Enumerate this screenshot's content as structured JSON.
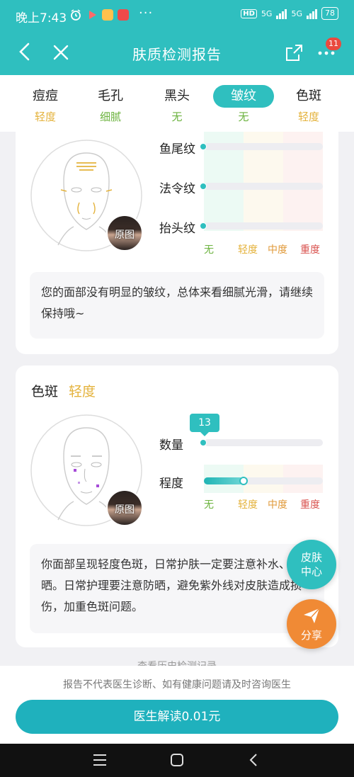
{
  "status_bar": {
    "time": "晚上7:43",
    "dots": "···",
    "hd": "HD",
    "net1": "5G",
    "net2": "5G",
    "battery": "78",
    "app_icon_colors": [
      "#ffffff",
      "#ff6a6a",
      "#ffc14d",
      "#f04a4a"
    ]
  },
  "nav": {
    "title": "肤质检测报告",
    "badge": "11"
  },
  "tabs": [
    {
      "label": "痘痘",
      "level": "轻度",
      "color": "#e4b23b"
    },
    {
      "label": "毛孔",
      "level": "细腻",
      "color": "#6cb33f"
    },
    {
      "label": "黑头",
      "level": "无",
      "color": "#6cb33f"
    },
    {
      "label": "皱纹",
      "level": "无",
      "color": "#6cb33f",
      "active": true
    },
    {
      "label": "色斑",
      "level": "轻度",
      "color": "#e4b23b"
    }
  ],
  "wrinkles": {
    "rows": [
      {
        "label": "鱼尾纹",
        "value": 0
      },
      {
        "label": "法令纹",
        "value": 0
      },
      {
        "label": "抬头纹",
        "value": 0
      }
    ],
    "scale": [
      "无",
      "轻度",
      "中度",
      "重度"
    ],
    "original_label": "原图",
    "note": "您的面部没有明显的皱纹，总体来看细腻光滑，请继续保持哦~"
  },
  "spots": {
    "title": "色斑",
    "level": "轻度",
    "count": "13",
    "rows": [
      {
        "label": "数量",
        "value": 0
      },
      {
        "label": "程度",
        "value": 0.33
      }
    ],
    "scale": [
      "无",
      "轻度",
      "中度",
      "重度"
    ],
    "original_label": "原图",
    "note": "你面部呈现轻度色斑，日常护肤一定要注意补水、防晒。日常护理要注意防晒，避免紫外线对皮肤造成损伤，加重色斑问题。"
  },
  "fab": {
    "center_label_1": "皮肤",
    "center_label_2": "中心",
    "share_label": "分享"
  },
  "peek_text": "查看历史检测记录",
  "footer": {
    "disclaimer": "报告不代表医生诊断、如有健康问题请及时咨询医生",
    "cta": "医生解读0.01元"
  }
}
